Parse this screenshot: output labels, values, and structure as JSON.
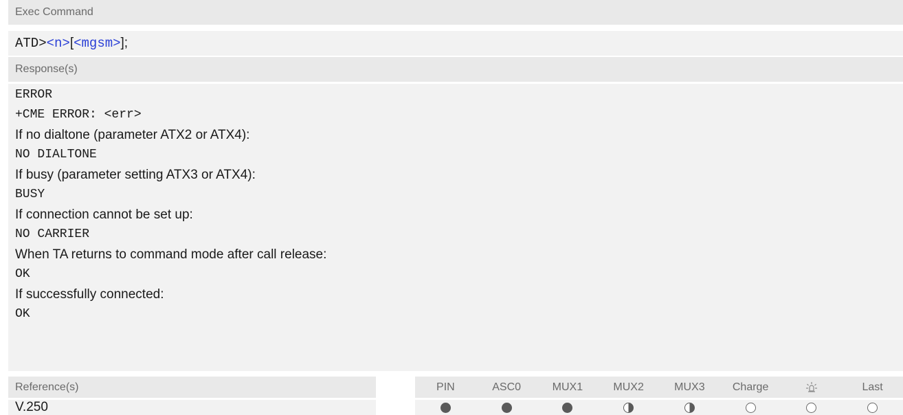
{
  "exec": {
    "label": "Exec Command",
    "cmd_prefix": "ATD>",
    "param_n": "<n>",
    "open_bracket": "[",
    "param_mgsm": "<mgsm>",
    "close": "];"
  },
  "response": {
    "label": "Response(s)",
    "lines": [
      {
        "text": "ERROR",
        "style": "mono"
      },
      {
        "text": "+CME ERROR: <err>",
        "style": "mono"
      },
      {
        "text": "If no dialtone (parameter ATX2 or ATX4):",
        "style": "sans"
      },
      {
        "text": "NO DIALTONE",
        "style": "mono"
      },
      {
        "text": "If busy (parameter setting ATX3 or ATX4):",
        "style": "sans"
      },
      {
        "text": "BUSY",
        "style": "mono"
      },
      {
        "text": "If connection cannot be set up:",
        "style": "sans"
      },
      {
        "text": "NO CARRIER",
        "style": "mono"
      },
      {
        "text": "When TA returns to command mode after call release:",
        "style": "sans"
      },
      {
        "text": "OK",
        "style": "mono"
      },
      {
        "text": "If successfully connected:",
        "style": "sans"
      },
      {
        "text": "OK",
        "style": "mono"
      }
    ]
  },
  "reference": {
    "label": "Reference(s)",
    "value": "V.250"
  },
  "columns": [
    {
      "label": "PIN",
      "state": "full"
    },
    {
      "label": "ASC0",
      "state": "full"
    },
    {
      "label": "MUX1",
      "state": "full"
    },
    {
      "label": "MUX2",
      "state": "half"
    },
    {
      "label": "MUX3",
      "state": "half"
    },
    {
      "label": "Charge",
      "state": "empty"
    },
    {
      "label": "",
      "icon": "alarm-sun-icon",
      "state": "empty"
    },
    {
      "label": "Last",
      "state": "empty"
    }
  ]
}
